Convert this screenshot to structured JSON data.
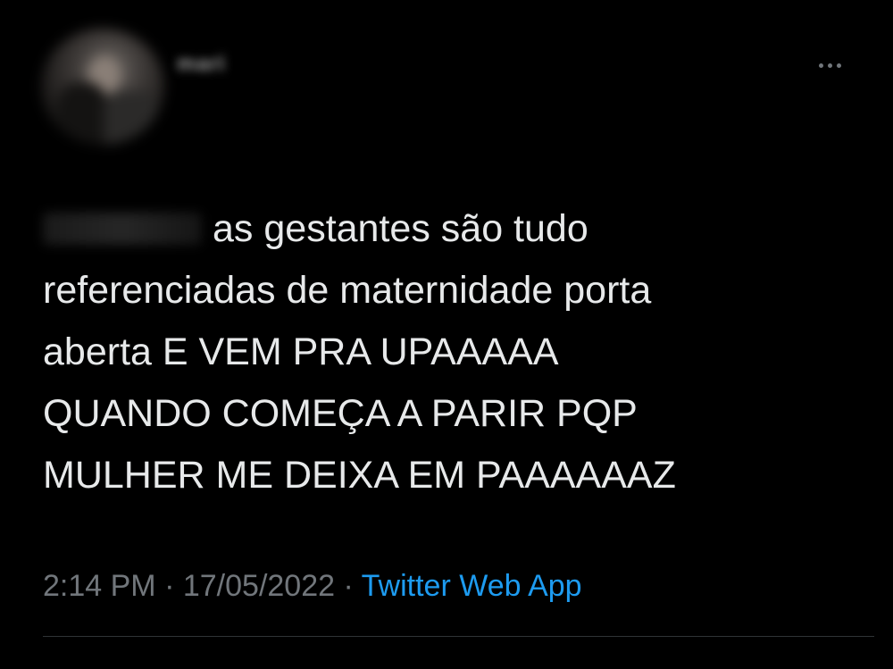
{
  "tweet": {
    "display_name": "mari",
    "text_line1": "as gestantes são tudo",
    "text_rest": "referenciadas de maternidade porta\naberta E VEM PRA UPAAAAA\nQUANDO COMEÇA A PARIR PQP\nMULHER ME DEIXA EM PAAAAAAZ",
    "time": "2:14 PM",
    "separator": "·",
    "date": "17/05/2022",
    "source": "Twitter Web App"
  },
  "icons": {
    "more": "more-horizontal-icon"
  },
  "colors": {
    "background": "#000000",
    "text": "#e7e9ea",
    "secondary": "#71767b",
    "link": "#1d9bf0",
    "divider": "#2f3336"
  }
}
